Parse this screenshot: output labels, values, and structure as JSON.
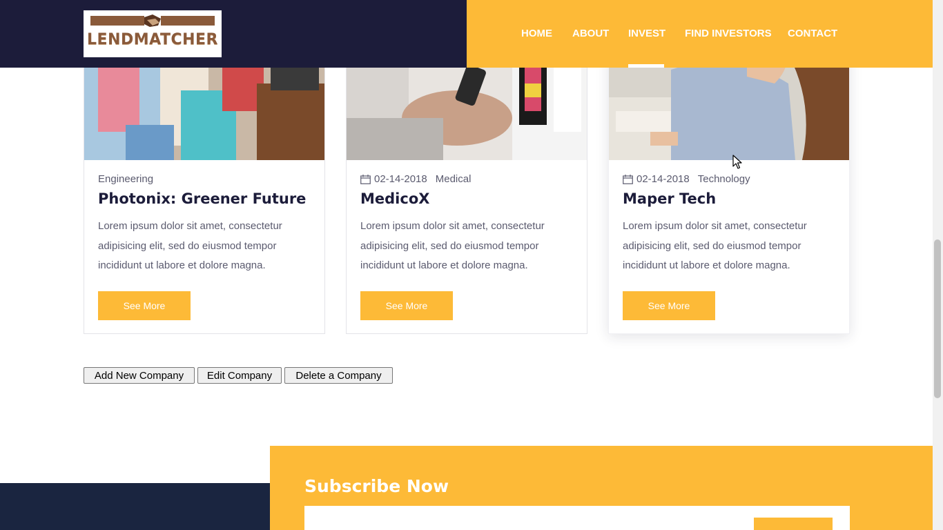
{
  "header": {
    "logo_text": "LENDMATCHER",
    "nav": [
      "HOME",
      "ABOUT",
      "INVEST",
      "FIND INVESTORS",
      "CONTACT"
    ],
    "active_nav": "INVEST"
  },
  "cards": [
    {
      "date": "",
      "category": "Engineering",
      "title": "Photonix: Greener Future",
      "description": "Lorem ipsum dolor sit amet, consectetur adipisicing elit, sed do eiusmod tempor incididunt ut labore et dolore magna.",
      "button": "See More"
    },
    {
      "date": "02-14-2018",
      "category": "Medical",
      "title": "MedicoX",
      "description": "Lorem ipsum dolor sit amet, consectetur adipisicing elit, sed do eiusmod tempor incididunt ut labore et dolore magna.",
      "button": "See More"
    },
    {
      "date": "02-14-2018",
      "category": "Technology",
      "title": "Maper Tech",
      "description": "Lorem ipsum dolor sit amet, consectetur adipisicing elit, sed do eiusmod tempor incididunt ut labore et dolore magna.",
      "button": "See More"
    }
  ],
  "admin_buttons": {
    "add": "Add New Company",
    "edit": "Edit Company",
    "delete": "Delete a Company"
  },
  "subscribe": {
    "title": "Subscribe Now"
  },
  "icons": {
    "calendar": "calendar-icon",
    "cursor": "mouse-pointer-icon"
  },
  "colors": {
    "navy": "#1c1c3a",
    "accent": "#fdba37",
    "footer_dark": "#1a2540",
    "text": "#5a5a6e"
  }
}
